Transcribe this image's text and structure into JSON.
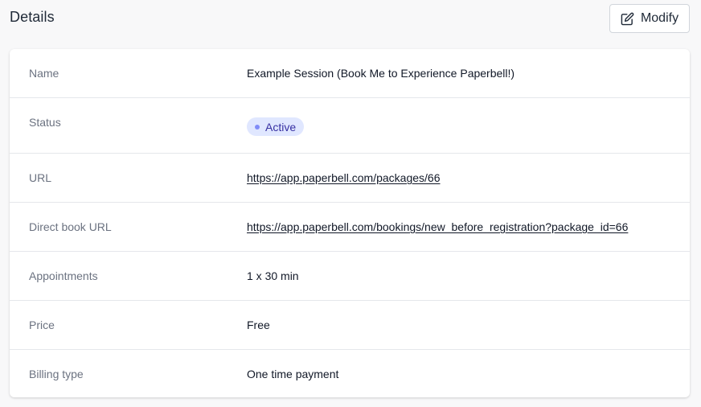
{
  "header": {
    "title": "Details",
    "modify_label": "Modify",
    "modify_icon": "edit-icon"
  },
  "details": {
    "name": {
      "label": "Name",
      "value": "Example Session (Book Me to Experience Paperbell!)"
    },
    "status": {
      "label": "Status",
      "value": "Active",
      "color": "#e0e7ff",
      "text_color": "#3730a3"
    },
    "url": {
      "label": "URL",
      "value": "https://app.paperbell.com/packages/66"
    },
    "direct_book_url": {
      "label": "Direct book URL",
      "value": "https://app.paperbell.com/bookings/new_before_registration?package_id=66"
    },
    "appointments": {
      "label": "Appointments",
      "value": "1 x 30 min"
    },
    "price": {
      "label": "Price",
      "value": "Free"
    },
    "billing_type": {
      "label": "Billing type",
      "value": "One time payment"
    }
  }
}
